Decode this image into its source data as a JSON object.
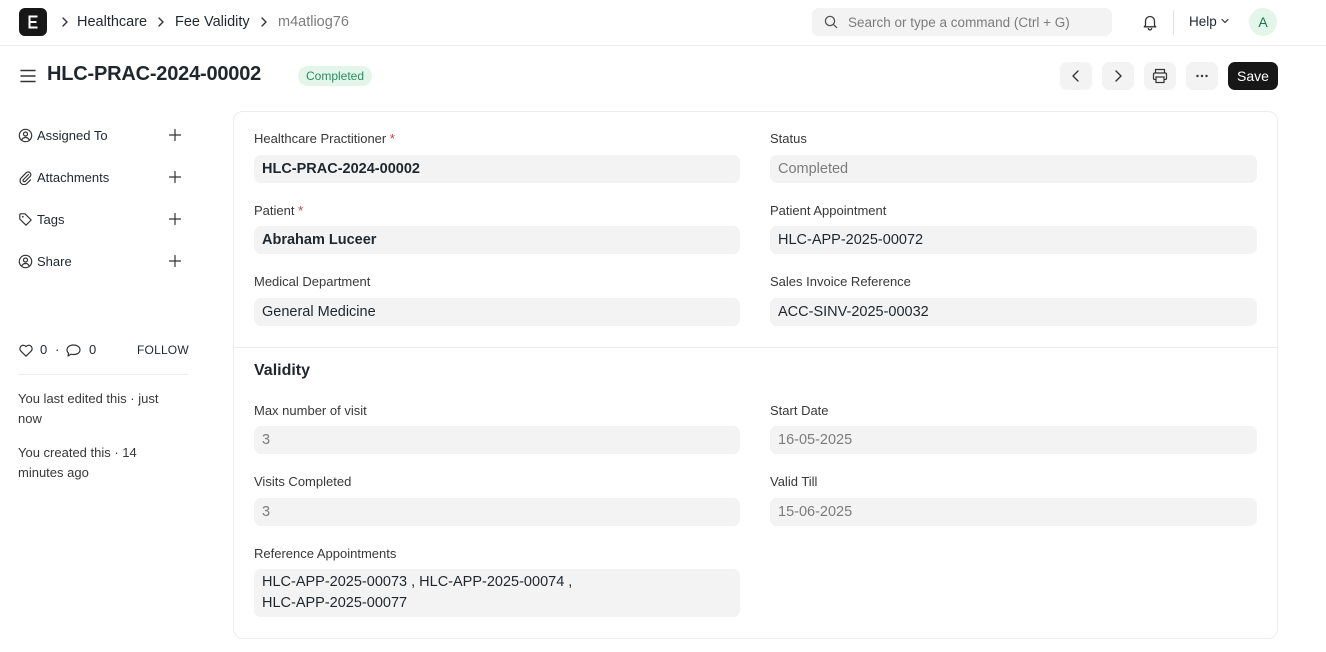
{
  "navbar": {
    "breadcrumbs": [
      "Healthcare",
      "Fee Validity",
      "m4atliog76"
    ],
    "search_placeholder": "Search or type a command (Ctrl + G)",
    "help_label": "Help",
    "avatar_initial": "A"
  },
  "page": {
    "title": "HLC-PRAC-2024-00002",
    "status": "Completed",
    "save_label": "Save"
  },
  "sidebar": {
    "items": [
      {
        "label": "Assigned To",
        "icon": "user-assign-icon"
      },
      {
        "label": "Attachments",
        "icon": "paperclip-icon"
      },
      {
        "label": "Tags",
        "icon": "tag-icon"
      },
      {
        "label": "Share",
        "icon": "share-user-icon"
      }
    ],
    "likes_count": "0",
    "comments_count": "0",
    "follow_label": "FOLLOW",
    "activity": [
      "You last edited this · just now",
      "You created this · 14 minutes ago"
    ]
  },
  "form": {
    "practitioner": {
      "label": "Healthcare Practitioner",
      "value": "HLC-PRAC-2024-00002"
    },
    "status": {
      "label": "Status",
      "value": "Completed"
    },
    "patient": {
      "label": "Patient",
      "value": "Abraham Luceer"
    },
    "patient_appointment": {
      "label": "Patient Appointment",
      "value": "HLC-APP-2025-00072"
    },
    "medical_department": {
      "label": "Medical Department",
      "value": "General Medicine"
    },
    "sales_invoice": {
      "label": "Sales Invoice Reference",
      "value": "ACC-SINV-2025-00032"
    },
    "validity_section": "Validity",
    "max_visits": {
      "label": "Max number of visit",
      "value": "3"
    },
    "start_date": {
      "label": "Start Date",
      "value": "16-05-2025"
    },
    "visits_completed": {
      "label": "Visits Completed",
      "value": "3"
    },
    "valid_till": {
      "label": "Valid Till",
      "value": "15-06-2025"
    },
    "reference_appointments": {
      "label": "Reference Appointments",
      "value": "HLC-APP-2025-00073 , HLC-APP-2025-00074 , HLC-APP-2025-00077"
    }
  },
  "colors": {
    "accent": "#171717",
    "status_bg": "#e4f5e9",
    "status_text": "#278f5e",
    "required": "#e03636"
  }
}
